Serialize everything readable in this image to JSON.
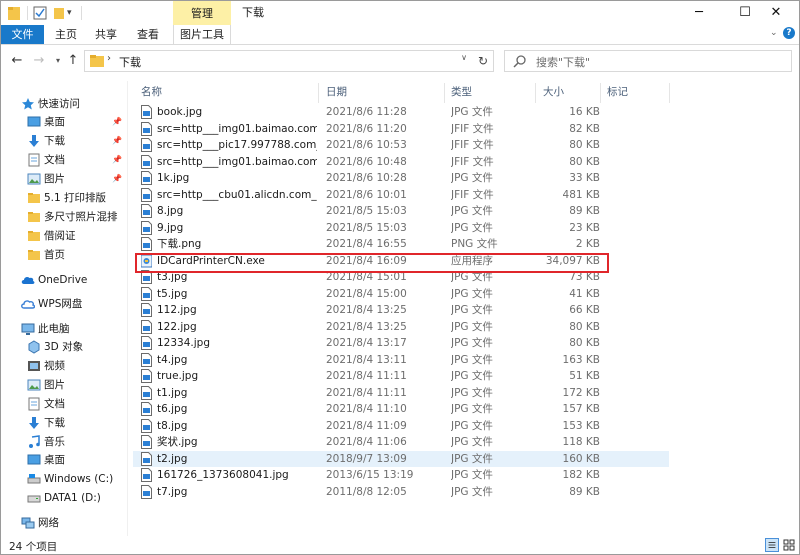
{
  "window": {
    "title": "下载",
    "context_tab": "管理",
    "minimize": "─",
    "maximize": "☐",
    "close": "✕"
  },
  "ribbon": {
    "file": "文件",
    "home": "主页",
    "share": "共享",
    "view": "查看",
    "image_tools": "图片工具",
    "help": "?"
  },
  "address": {
    "path": "下载",
    "search_placeholder": "搜索\"下载\""
  },
  "nav": {
    "quick_access": "快速访问",
    "quick_items": [
      {
        "label": "桌面",
        "icon": "desktop-icon",
        "pinned": true
      },
      {
        "label": "下载",
        "icon": "download-icon",
        "pinned": true
      },
      {
        "label": "文档",
        "icon": "document-icon",
        "pinned": true
      },
      {
        "label": "图片",
        "icon": "picture-icon",
        "pinned": true
      },
      {
        "label": "5.1 打印排版",
        "icon": "folder-icon",
        "pinned": false
      },
      {
        "label": "多尺寸照片混排",
        "icon": "folder-icon",
        "pinned": false
      },
      {
        "label": "借阅证",
        "icon": "folder-icon",
        "pinned": false
      },
      {
        "label": "首页",
        "icon": "folder-icon",
        "pinned": false
      }
    ],
    "onedrive": "OneDrive",
    "wps": "WPS网盘",
    "this_pc": "此电脑",
    "pc_items": [
      {
        "label": "3D 对象",
        "icon": "3d-objects-icon"
      },
      {
        "label": "视频",
        "icon": "video-icon"
      },
      {
        "label": "图片",
        "icon": "picture-icon"
      },
      {
        "label": "文档",
        "icon": "document-icon"
      },
      {
        "label": "下载",
        "icon": "download-icon"
      },
      {
        "label": "音乐",
        "icon": "music-icon"
      },
      {
        "label": "桌面",
        "icon": "desktop-icon"
      },
      {
        "label": "Windows (C:)",
        "icon": "drive-c-icon"
      },
      {
        "label": "DATA1 (D:)",
        "icon": "drive-d-icon"
      }
    ],
    "network": "网络"
  },
  "columns": {
    "name": "名称",
    "date": "日期",
    "type": "类型",
    "size": "大小",
    "tags": "标记"
  },
  "files": [
    {
      "name": "book.jpg",
      "date": "2021/8/6 11:28",
      "type": "JPG 文件",
      "size": "16 KB"
    },
    {
      "name": "src=http___img01.baimao.com_M...",
      "date": "2021/8/6 11:20",
      "type": "JFIF 文件",
      "size": "82 KB"
    },
    {
      "name": "src=http___pic17.997788.com_pic...",
      "date": "2021/8/6 10:53",
      "type": "JFIF 文件",
      "size": "80 KB"
    },
    {
      "name": "src=http___img01.baimao.com_M...",
      "date": "2021/8/6 10:48",
      "type": "JFIF 文件",
      "size": "80 KB"
    },
    {
      "name": "1k.jpg",
      "date": "2021/8/6 10:28",
      "type": "JPG 文件",
      "size": "33 KB"
    },
    {
      "name": "src=http___cbu01.alicdn.com_img...",
      "date": "2021/8/6 10:01",
      "type": "JFIF 文件",
      "size": "481 KB"
    },
    {
      "name": "8.jpg",
      "date": "2021/8/5 15:03",
      "type": "JPG 文件",
      "size": "89 KB"
    },
    {
      "name": "9.jpg",
      "date": "2021/8/5 15:03",
      "type": "JPG 文件",
      "size": "23 KB"
    },
    {
      "name": "下载.png",
      "date": "2021/8/4 16:55",
      "type": "PNG 文件",
      "size": "2 KB"
    },
    {
      "name": "IDCardPrinterCN.exe",
      "date": "2021/8/4 16:09",
      "type": "应用程序",
      "size": "34,097 KB"
    },
    {
      "name": "t3.jpg",
      "date": "2021/8/4 15:01",
      "type": "JPG 文件",
      "size": "73 KB"
    },
    {
      "name": "t5.jpg",
      "date": "2021/8/4 15:00",
      "type": "JPG 文件",
      "size": "41 KB"
    },
    {
      "name": "112.jpg",
      "date": "2021/8/4 13:25",
      "type": "JPG 文件",
      "size": "66 KB"
    },
    {
      "name": "122.jpg",
      "date": "2021/8/4 13:25",
      "type": "JPG 文件",
      "size": "80 KB"
    },
    {
      "name": "12334.jpg",
      "date": "2021/8/4 13:17",
      "type": "JPG 文件",
      "size": "80 KB"
    },
    {
      "name": "t4.jpg",
      "date": "2021/8/4 13:11",
      "type": "JPG 文件",
      "size": "163 KB"
    },
    {
      "name": "true.jpg",
      "date": "2021/8/4 11:11",
      "type": "JPG 文件",
      "size": "51 KB"
    },
    {
      "name": "t1.jpg",
      "date": "2021/8/4 11:11",
      "type": "JPG 文件",
      "size": "172 KB"
    },
    {
      "name": "t6.jpg",
      "date": "2021/8/4 11:10",
      "type": "JPG 文件",
      "size": "157 KB"
    },
    {
      "name": "t8.jpg",
      "date": "2021/8/4 11:09",
      "type": "JPG 文件",
      "size": "153 KB"
    },
    {
      "name": "奖状.jpg",
      "date": "2021/8/4 11:06",
      "type": "JPG 文件",
      "size": "118 KB"
    },
    {
      "name": "t2.jpg",
      "date": "2018/9/7 13:09",
      "type": "JPG 文件",
      "size": "160 KB"
    },
    {
      "name": "161726_1373608041.jpg",
      "date": "2013/6/15 13:19",
      "type": "JPG 文件",
      "size": "182 KB"
    },
    {
      "name": "t7.jpg",
      "date": "2011/8/8 12:05",
      "type": "JPG 文件",
      "size": "89 KB"
    }
  ],
  "selected_index": 21,
  "highlighted_index": 9,
  "status": {
    "count": "24 个项目"
  },
  "colors": {
    "accent": "#1979ca",
    "context_tab": "#fdf0a6",
    "highlight_box": "#e0262b",
    "selection": "#e5f1fb",
    "folder": "#f4c54a"
  }
}
